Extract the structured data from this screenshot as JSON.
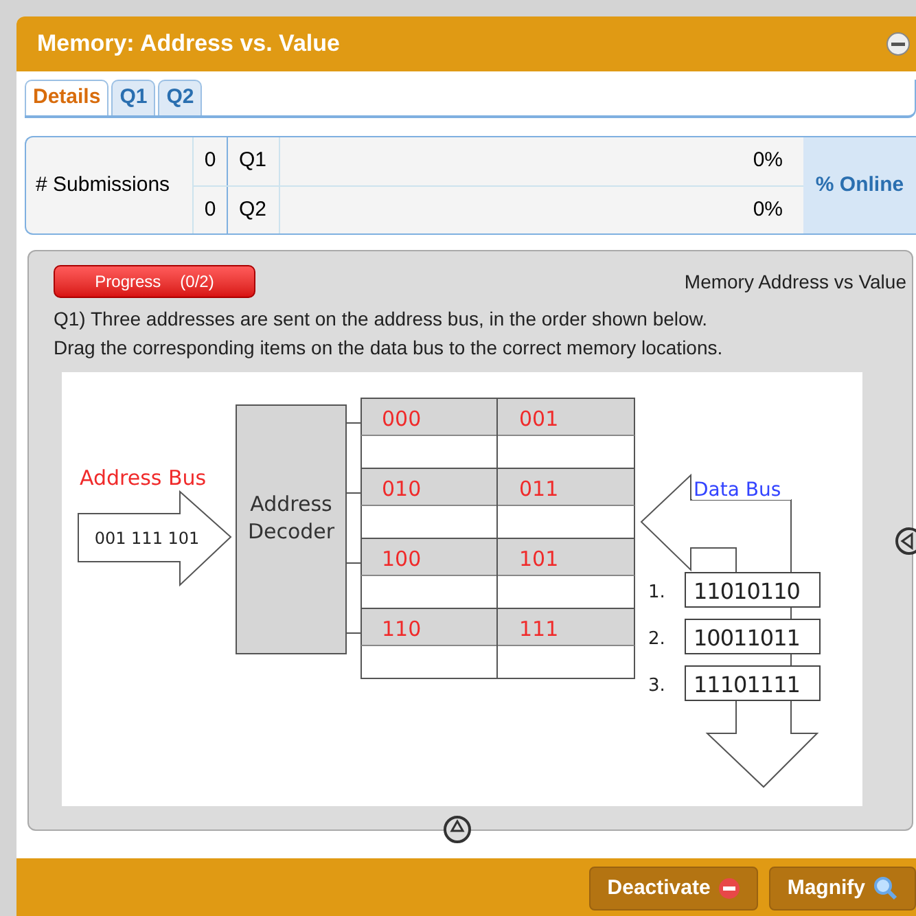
{
  "panel": {
    "title": "Memory: Address vs. Value"
  },
  "tabs": [
    {
      "label": "Details",
      "selected": true
    },
    {
      "label": "Q1",
      "selected": false
    },
    {
      "label": "Q2",
      "selected": false
    }
  ],
  "submissions": {
    "label": "# Submissions",
    "online_label": "% Online",
    "rows": [
      {
        "count": "0",
        "question": "Q1",
        "percent": "0%"
      },
      {
        "count": "0",
        "question": "Q2",
        "percent": "0%"
      }
    ]
  },
  "activity": {
    "progress_label": "Progress",
    "progress_count": "(0/2)",
    "title": "Memory Address vs Value",
    "question": "Q1) Three addresses are sent on the address bus, in the order shown below.",
    "instruction": "Drag the corresponding items on the data bus to the correct memory locations."
  },
  "diagram": {
    "address_bus_label": "Address Bus",
    "address_value": "001 111 101",
    "decoder_label": "Address Decoder",
    "memory_addresses": [
      "000",
      "001",
      "010",
      "011",
      "100",
      "101",
      "110",
      "111"
    ],
    "data_bus_label": "Data Bus",
    "data_items": [
      {
        "number": "1.",
        "value": "11010110"
      },
      {
        "number": "2.",
        "value": "10011011"
      },
      {
        "number": "3.",
        "value": "11101111"
      }
    ]
  },
  "footer": {
    "buttons": [
      {
        "label": "Deactivate",
        "kind": "deactivate"
      },
      {
        "label": "Magnify",
        "kind": "magnify"
      }
    ]
  }
}
